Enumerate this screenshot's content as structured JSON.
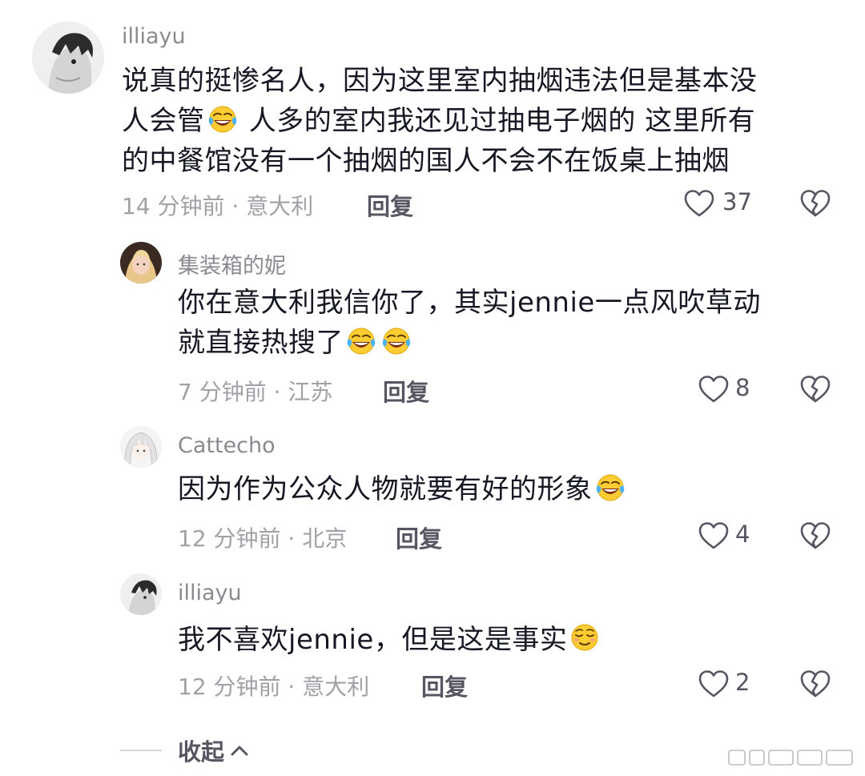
{
  "comments": [
    {
      "username": "illiayu",
      "text_lines": [
        "说真的挺惨名人，因为这里室内抽烟违法但是基本没",
        "人会管",
        " 人多的室内我还见过抽电子烟的 这里所有",
        "的中餐馆没有一个抽烟的国人不会不在饭桌上抽烟"
      ],
      "time_location": "14 分钟前 · 意大利",
      "reply_label": "回复",
      "like_count": "37"
    },
    {
      "username": "集装箱的妮",
      "text_lines": [
        "你在意大利我信你了，其实jennie一点风吹草动",
        "就直接热搜了"
      ],
      "time_location": "7 分钟前 · 江苏",
      "reply_label": "回复",
      "like_count": "8"
    },
    {
      "username": "Cattecho",
      "text_lines": [
        "因为作为公众人物就要有好的形象"
      ],
      "time_location": "12 分钟前 · 北京",
      "reply_label": "回复",
      "like_count": "4"
    },
    {
      "username": "illiayu",
      "text_lines": [
        "我不喜欢jennie，但是这是事实"
      ],
      "time_location": "12 分钟前 · 意大利",
      "reply_label": "回复",
      "like_count": "2"
    }
  ],
  "collapse_label": "收起",
  "icons": {
    "emoji_laugh_cry": "rolling-on-floor-laughing-emoji",
    "emoji_relieved": "relieved-face-emoji",
    "like": "heart-outline-icon",
    "dislike": "broken-heart-icon",
    "collapse": "chevron-up-icon"
  },
  "colors": {
    "text_primary": "#161823",
    "text_secondary": "#8a8b91",
    "text_meta": "#a1a2a7",
    "action": "#555661"
  }
}
